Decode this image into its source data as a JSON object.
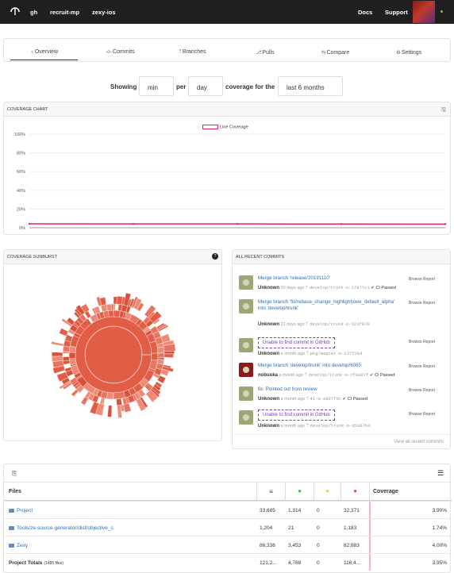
{
  "topbar": {
    "nav": [
      "gh",
      "recruit-mp",
      "zexy-ios"
    ],
    "docs": "Docs",
    "support": "Support"
  },
  "tabs": [
    {
      "icon": "♁",
      "label": "Overview"
    },
    {
      "icon": "-o-",
      "label": "Commits"
    },
    {
      "icon": "ᛘ",
      "label": "Branches"
    },
    {
      "icon": "⎇",
      "label": "Pulls"
    },
    {
      "icon": "⇆",
      "label": "Compare"
    },
    {
      "icon": "⚙",
      "label": "Settings"
    }
  ],
  "showing": {
    "t1": "Showing",
    "stat": "min",
    "t2": "per",
    "period": "day",
    "t3": "coverage for the",
    "range": "last 6 months"
  },
  "coverage_chart": {
    "title": "COVERAGE CHART",
    "legend": "Line Coverage",
    "yticks": [
      "100%",
      "80%",
      "60%",
      "40%",
      "20%",
      "0%"
    ],
    "color": "#e91e63"
  },
  "chart_data": {
    "type": "line",
    "series": [
      {
        "name": "Line Coverage",
        "values": [
          4.2,
          4.1,
          4.1,
          4.0,
          3.95
        ]
      }
    ],
    "ylim": [
      0,
      100
    ],
    "yticks": [
      "100%",
      "80%",
      "60%",
      "40%",
      "20%",
      "0%"
    ]
  },
  "sunburst": {
    "title": "COVERAGE SUNBURST",
    "help": "?"
  },
  "commits": {
    "title": "ALL RECENT COMMITS",
    "items": [
      {
        "msg": "Merge branch 'release/20191110'",
        "author": "Unknown",
        "time": "20 days ago",
        "branch": "develop/trunk",
        "sha": "27877c1",
        "ci": "CI Passed",
        "browse": "Browse Report",
        "unable": false
      },
      {
        "msg": "Merge branch 'fix/rebase_change_highlightview_default_alpha' into 'develop/trunk'",
        "author": "Unknown",
        "time": "21 days ago",
        "branch": "develop/trunk",
        "sha": "323f870",
        "ci": "",
        "browse": "Browse Report",
        "unable": false
      },
      {
        "msg": "Unable to find commit in GitHub",
        "author": "Unknown",
        "time": "a month ago",
        "branch": "pkg/master",
        "sha": "137f284",
        "ci": "",
        "browse": "Browse Report",
        "unable": true
      },
      {
        "msg": "Merge branch 'develop/trunk' into develop/6065",
        "author": "nobuoka",
        "time": "a month ago",
        "branch": "develop/trunk",
        "sha": "cf0a97f",
        "ci": "CI Passed",
        "browse": "Browse Report",
        "unable": false
      },
      {
        "msg": "fix: Pointed out from review",
        "author": "Unknown",
        "time": "a month ago",
        "branch": "41",
        "sha": "ad97fdc",
        "ci": "CI Passed",
        "browse": "Browse Report",
        "unable": false
      },
      {
        "msg": "Unable to find commit in GitHub",
        "author": "Unknown",
        "time": "a month ago",
        "branch": "develop/trunk",
        "sha": "d5367b4",
        "ci": "",
        "browse": "Browse Report",
        "unable": true
      }
    ],
    "view_all": "View all recent commits"
  },
  "files": {
    "header": {
      "files": "Files",
      "coverage": "Coverage"
    },
    "rows": [
      {
        "name": "Project",
        "lines": "33,685",
        "hits": "1,314",
        "partials": "0",
        "misses": "32,371",
        "coverage": "3.90%",
        "pct": 3.9
      },
      {
        "name": "Tools/ze-source-generator/dist/objective_c",
        "lines": "1,204",
        "hits": "21",
        "partials": "0",
        "misses": "1,183",
        "coverage": "1.74%",
        "pct": 1.74
      },
      {
        "name": "Zexy",
        "lines": "86,336",
        "hits": "3,453",
        "partials": "0",
        "misses": "82,883",
        "coverage": "4.00%",
        "pct": 4.0
      }
    ],
    "totals": {
      "label": "Project Totals",
      "count": "(1485 files)",
      "lines": "121,2...",
      "hits": "4,788",
      "partials": "0",
      "misses": "116,4...",
      "coverage": "3.95%"
    }
  }
}
